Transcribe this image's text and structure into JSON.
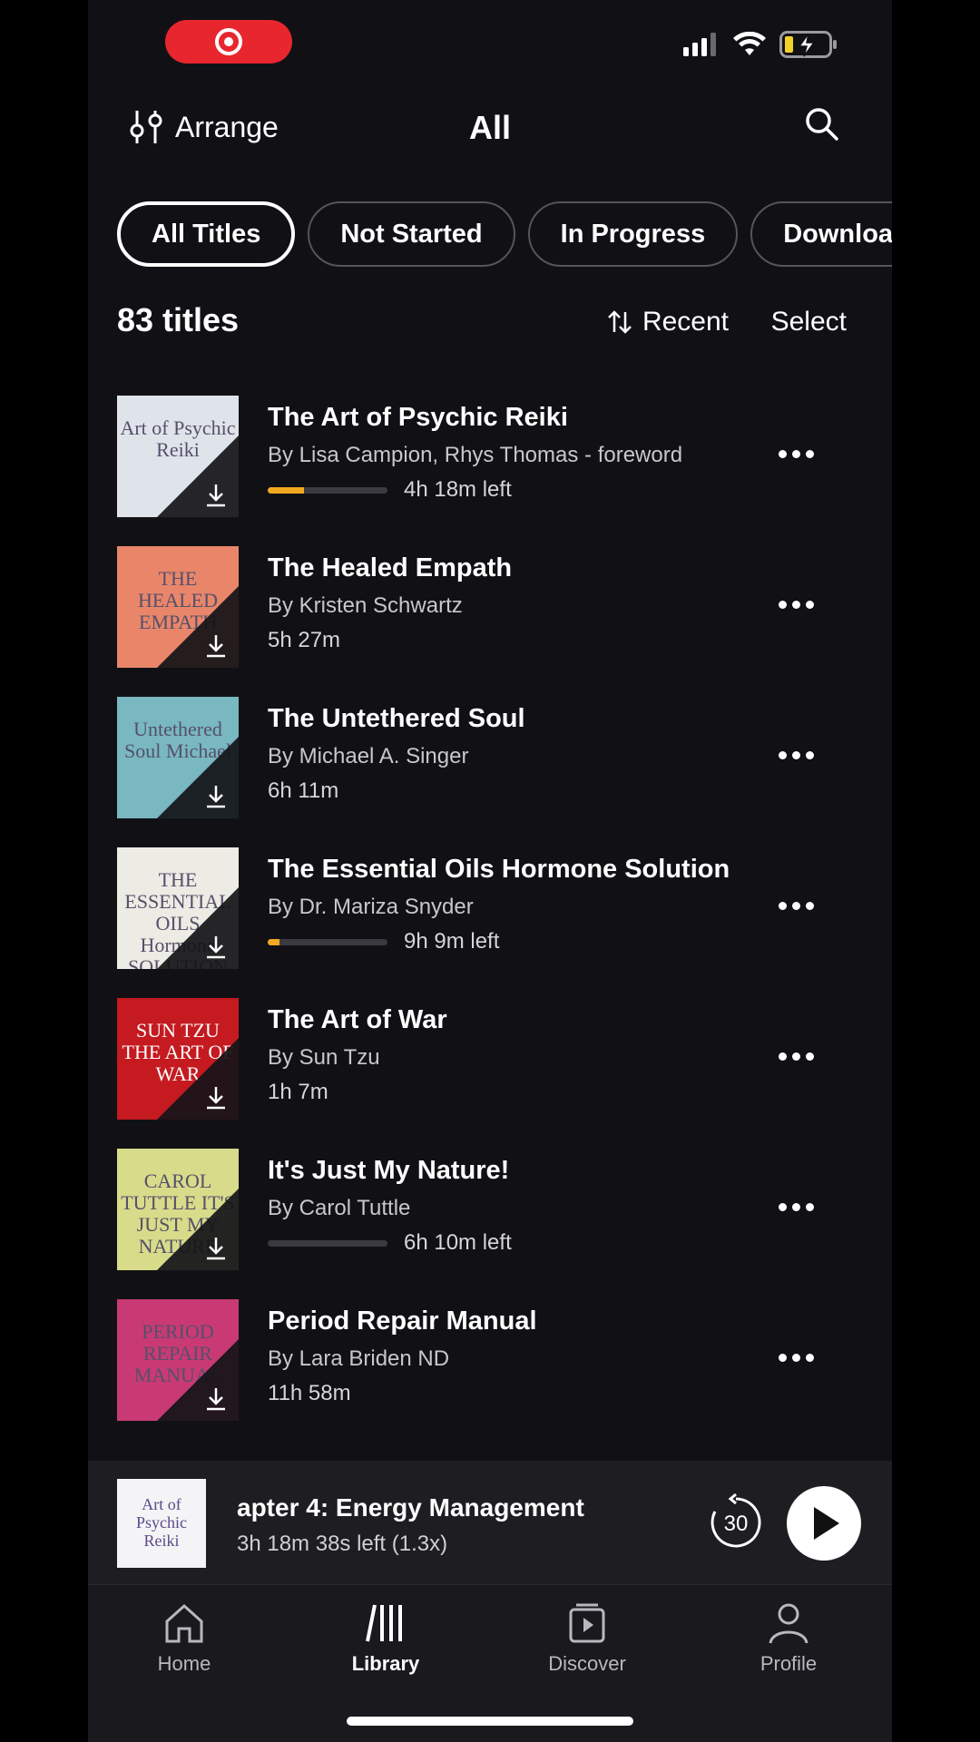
{
  "header": {
    "arrange_label": "Arrange",
    "title": "All"
  },
  "filters": [
    {
      "label": "All Titles",
      "active": true
    },
    {
      "label": "Not Started",
      "active": false
    },
    {
      "label": "In Progress",
      "active": false
    },
    {
      "label": "Downloaded",
      "active": false
    }
  ],
  "library": {
    "count_label": "83 titles",
    "sort_label": "Recent",
    "select_label": "Select"
  },
  "items": [
    {
      "title": "The Art of Psychic Reiki",
      "author": "By Lisa Campion, Rhys Thomas - foreword",
      "status": "4h 18m left",
      "progress": 0.3,
      "cover_text": "Art of Psychic Reiki",
      "cover_color": "#dfe3ea"
    },
    {
      "title": "The Healed Empath",
      "author": "By Kristen Schwartz",
      "status": "5h 27m",
      "progress": null,
      "cover_text": "THE HEALED EMPATH",
      "cover_color": "#e9866a"
    },
    {
      "title": "The Untethered Soul",
      "author": "By Michael A. Singer",
      "status": "6h 11m",
      "progress": null,
      "cover_text": "Untethered Soul Michael",
      "cover_color": "#79b8c0"
    },
    {
      "title": "The Essential Oils Hormone Solution",
      "author": "By Dr. Mariza Snyder",
      "status": "9h 9m left",
      "progress": 0.1,
      "cover_text": "THE ESSENTIAL OILS Hormone SOLUTION",
      "cover_color": "#ecebe4"
    },
    {
      "title": "The Art of War",
      "author": "By Sun Tzu",
      "status": "1h 7m",
      "progress": null,
      "cover_text": "SUN TZU THE ART OF WAR",
      "cover_color": "#c41a20"
    },
    {
      "title": "It's Just My Nature!",
      "author": "By Carol Tuttle",
      "status": "6h 10m left",
      "progress": 0.0,
      "cover_text": "CAROL TUTTLE IT'S JUST MY NATURE",
      "cover_color": "#d8dc8a"
    },
    {
      "title": "Period Repair Manual",
      "author": "By Lara Briden ND",
      "status": "11h 58m",
      "progress": null,
      "cover_text": "PERIOD REPAIR MANUAL",
      "cover_color": "#c93a74"
    }
  ],
  "player": {
    "chapter": "apter 4: Energy Management",
    "time_left": "3h 18m 38s left (1.3x)",
    "skip_label": "30",
    "thumb_text": "Art of Psychic Reiki"
  },
  "tabs": [
    {
      "label": "Home",
      "icon": "home-icon"
    },
    {
      "label": "Library",
      "icon": "library-icon",
      "active": true
    },
    {
      "label": "Discover",
      "icon": "discover-icon"
    },
    {
      "label": "Profile",
      "icon": "profile-icon"
    }
  ],
  "colors": {
    "accent": "#f2a821",
    "background": "#111115",
    "record": "#e8262e"
  }
}
